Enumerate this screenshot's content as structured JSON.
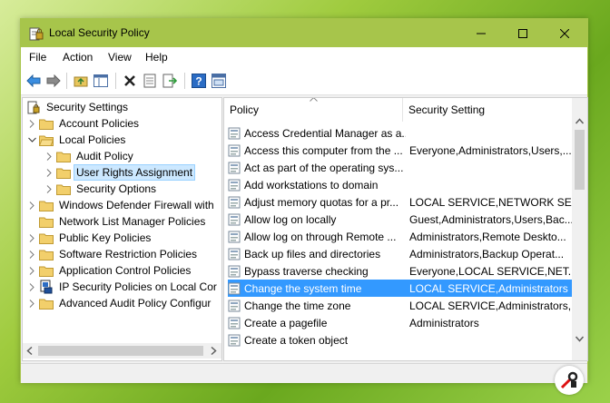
{
  "window": {
    "title": "Local Security Policy",
    "controls": {
      "minimize": "minimize-icon",
      "maximize": "maximize-icon",
      "close": "close-icon"
    }
  },
  "menu": {
    "items": [
      "File",
      "Action",
      "View",
      "Help"
    ]
  },
  "toolbar": {
    "icons": [
      "back-arrow-icon",
      "forward-arrow-icon",
      "up-folder-icon",
      "show-hide-tree-icon",
      "delete-icon",
      "properties-icon",
      "export-list-icon",
      "help-icon",
      "console-icon"
    ]
  },
  "tree": {
    "items": [
      {
        "label": "Security Settings",
        "icon": "security-settings-icon",
        "expanded": true
      },
      {
        "label": "Account Policies",
        "icon": "folder-icon"
      },
      {
        "label": "Local Policies",
        "icon": "folder-open-icon",
        "expanded": true
      },
      {
        "label": "Audit Policy",
        "icon": "folder-icon"
      },
      {
        "label": "User Rights Assignment",
        "icon": "folder-icon",
        "selected": true
      },
      {
        "label": "Security Options",
        "icon": "folder-icon"
      },
      {
        "label": "Windows Defender Firewall with",
        "icon": "folder-icon"
      },
      {
        "label": "Network List Manager Policies",
        "icon": "folder-icon"
      },
      {
        "label": "Public Key Policies",
        "icon": "folder-icon"
      },
      {
        "label": "Software Restriction Policies",
        "icon": "folder-icon"
      },
      {
        "label": "Application Control Policies",
        "icon": "folder-icon"
      },
      {
        "label": "IP Security Policies on Local Cor",
        "icon": "ip-security-icon"
      },
      {
        "label": "Advanced Audit Policy Configur",
        "icon": "folder-icon"
      }
    ]
  },
  "list": {
    "columns": {
      "policy": "Policy",
      "setting": "Security Setting"
    },
    "rows": [
      {
        "policy": "Access Credential Manager as a...",
        "setting": ""
      },
      {
        "policy": "Access this computer from the ...",
        "setting": "Everyone,Administrators,Users,..."
      },
      {
        "policy": "Act as part of the operating sys...",
        "setting": ""
      },
      {
        "policy": "Add workstations to domain",
        "setting": ""
      },
      {
        "policy": "Adjust memory quotas for a pr...",
        "setting": "LOCAL SERVICE,NETWORK SER..."
      },
      {
        "policy": "Allow log on locally",
        "setting": "Guest,Administrators,Users,Bac..."
      },
      {
        "policy": "Allow log on through Remote ...",
        "setting": "Administrators,Remote Deskto..."
      },
      {
        "policy": "Back up files and directories",
        "setting": "Administrators,Backup Operat..."
      },
      {
        "policy": "Bypass traverse checking",
        "setting": "Everyone,LOCAL SERVICE,NET..."
      },
      {
        "policy": "Change the system time",
        "setting": "LOCAL SERVICE,Administrators",
        "selected": true
      },
      {
        "policy": "Change the time zone",
        "setting": "LOCAL SERVICE,Administrators,..."
      },
      {
        "policy": "Create a pagefile",
        "setting": "Administrators"
      },
      {
        "policy": "Create a token object",
        "setting": ""
      }
    ]
  },
  "colors": {
    "titlebar": "#a7c54b",
    "selection": "#3399ff",
    "tree_selection": "#cce8ff"
  }
}
